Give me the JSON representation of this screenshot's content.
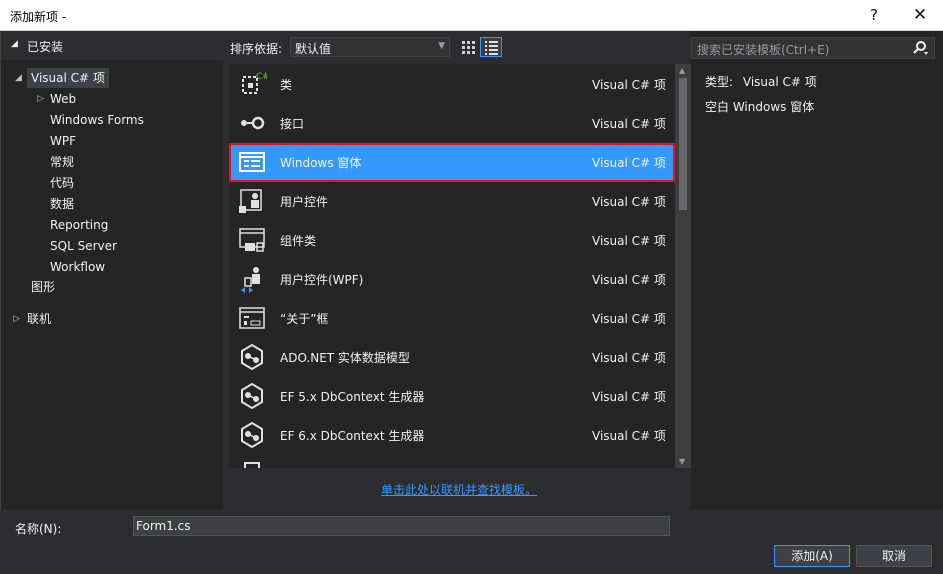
{
  "window": {
    "title": "添加新项 -",
    "help": "?",
    "close": "✕"
  },
  "sidebar": {
    "header": "已安装",
    "tree": [
      {
        "label": "Visual C# 项"
      },
      {
        "label": "Web"
      },
      {
        "label": "Windows Forms"
      },
      {
        "label": "WPF"
      },
      {
        "label": "常规"
      },
      {
        "label": "代码"
      },
      {
        "label": "数据"
      },
      {
        "label": "Reporting"
      },
      {
        "label": "SQL Server"
      },
      {
        "label": "Workflow"
      },
      {
        "label": "图形"
      },
      {
        "label": "联机"
      }
    ]
  },
  "toolbar": {
    "sort_label": "排序依据:",
    "sort_value": "默认值"
  },
  "templates": [
    {
      "name": "类",
      "lang": "Visual C# 项",
      "icon": "class-icon"
    },
    {
      "name": "接口",
      "lang": "Visual C# 项",
      "icon": "interface-icon"
    },
    {
      "name": "Windows 窗体",
      "lang": "Visual C# 项",
      "icon": "windows-form-icon"
    },
    {
      "name": "用户控件",
      "lang": "Visual C# 项",
      "icon": "user-control-icon"
    },
    {
      "name": "组件类",
      "lang": "Visual C# 项",
      "icon": "component-class-icon"
    },
    {
      "name": "用户控件(WPF)",
      "lang": "Visual C# 项",
      "icon": "wpf-user-control-icon"
    },
    {
      "name": "“关于”框",
      "lang": "Visual C# 项",
      "icon": "about-box-icon"
    },
    {
      "name": "ADO.NET 实体数据模型",
      "lang": "Visual C# 项",
      "icon": "data-model-icon"
    },
    {
      "name": "EF 5.x DbContext 生成器",
      "lang": "Visual C# 项",
      "icon": "dbcontext-generator-icon"
    },
    {
      "name": "EF 6.x DbContext 生成器",
      "lang": "Visual C# 项",
      "icon": "dbcontext-generator-icon"
    }
  ],
  "online_link": "单击此处以联机并查找模板。",
  "search": {
    "placeholder": "搜索已安装模板(Ctrl+E)"
  },
  "details": {
    "type_label": "类型:",
    "type_value": "Visual C# 项",
    "description": "空白 Windows 窗体"
  },
  "bottom": {
    "name_label": "名称(N):",
    "name_value": "Form1.cs",
    "add_label": "添加(A)",
    "cancel_label": "取消"
  },
  "colors": {
    "accent": "#3399ff",
    "highlight_border": "#e81123",
    "background": "#252526"
  }
}
